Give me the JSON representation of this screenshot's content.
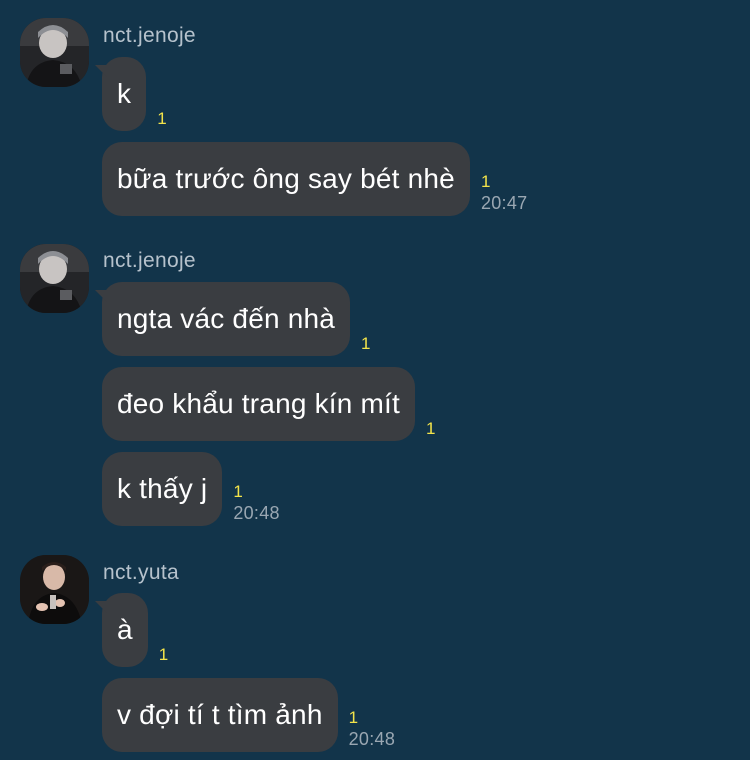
{
  "groups": [
    {
      "sender": "nct.jenoje",
      "messages": [
        {
          "text": "k",
          "read": "1",
          "time": ""
        },
        {
          "text": "bữa trước ông say bét nhè",
          "read": "1",
          "time": "20:47"
        }
      ]
    },
    {
      "sender": "nct.jenoje",
      "messages": [
        {
          "text": "ngta vác đến nhà",
          "read": "1",
          "time": ""
        },
        {
          "text": "đeo khẩu trang kín mít",
          "read": "1",
          "time": ""
        },
        {
          "text": "k thấy j",
          "read": "1",
          "time": "20:48"
        }
      ]
    },
    {
      "sender": "nct.yuta",
      "messages": [
        {
          "text": "à",
          "read": "1",
          "time": ""
        },
        {
          "text": "v đợi tí t tìm ảnh",
          "read": "1",
          "time": "20:48"
        }
      ]
    }
  ],
  "colors": {
    "background": "#12344a",
    "bubble": "#3a3d41",
    "read_count": "#f2e34a",
    "timestamp": "#9aa7b2",
    "sender_name": "#b6c2cc"
  },
  "icons": [
    "profile-avatar-jenoje",
    "profile-avatar-yuta"
  ]
}
